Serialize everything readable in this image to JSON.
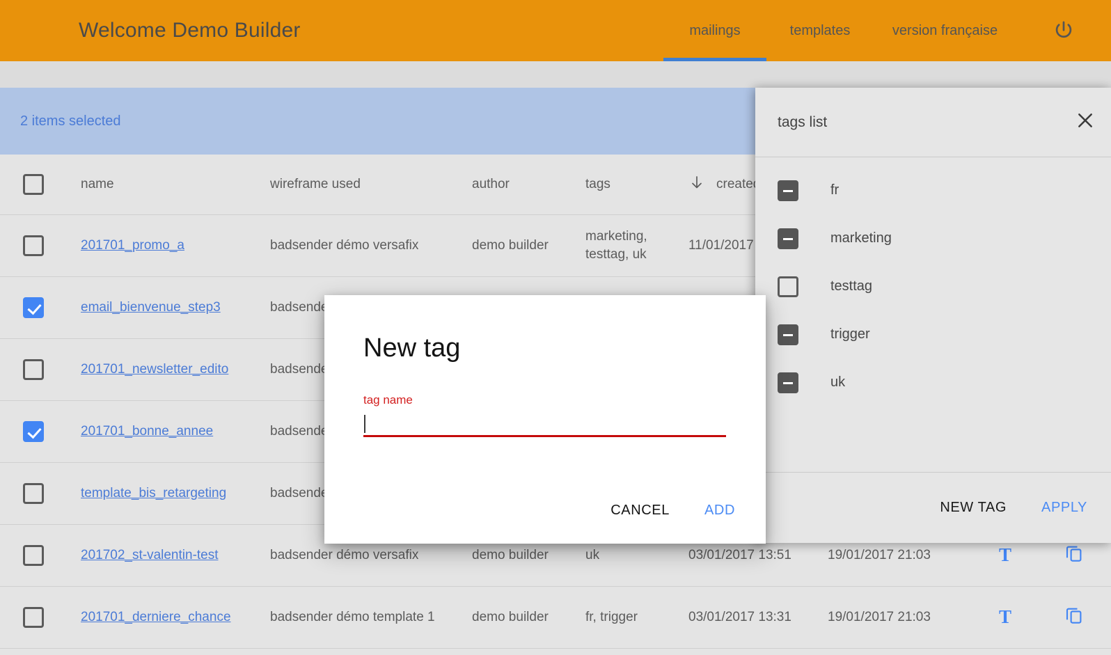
{
  "header": {
    "brand": "Welcome Demo Builder",
    "nav": [
      {
        "label": "mailings",
        "active": true
      },
      {
        "label": "templates",
        "active": false
      },
      {
        "label": "version française",
        "active": false
      }
    ],
    "power_icon": "power-icon"
  },
  "selection_bar": {
    "text": "2 items selected"
  },
  "table": {
    "columns": {
      "name": "name",
      "wireframe": "wireframe used",
      "author": "author",
      "tags": "tags",
      "created": "created",
      "sort_icon": "arrow-down-icon"
    },
    "rows": [
      {
        "checked": false,
        "name": "201701_promo_a",
        "wireframe": "badsender démo versafix",
        "author": "demo builder",
        "tags": "marketing, testtag, uk",
        "created": "11/01/2017",
        "updated": "",
        "action_text": "",
        "action_copy": ""
      },
      {
        "checked": true,
        "name": "email_bienvenue_step3",
        "wireframe": "badsende",
        "author": "",
        "tags": "",
        "created": "",
        "updated": "",
        "action_text": "",
        "action_copy": ""
      },
      {
        "checked": false,
        "name": "201701_newsletter_edito",
        "wireframe": "badsende",
        "author": "",
        "tags": "",
        "created": "",
        "updated": "",
        "action_text": "",
        "action_copy": ""
      },
      {
        "checked": true,
        "name": "201701_bonne_annee",
        "wireframe": "badsende",
        "author": "",
        "tags": "",
        "created": "",
        "updated": "",
        "action_text": "",
        "action_copy": ""
      },
      {
        "checked": false,
        "name": "template_bis_retargeting",
        "wireframe": "badsende",
        "author": "",
        "tags": "",
        "created": "",
        "updated": "",
        "action_text": "",
        "action_copy": ""
      },
      {
        "checked": false,
        "name": "201702_st-valentin-test",
        "wireframe": "badsender démo versafix",
        "author": "demo builder",
        "tags": "uk",
        "created": "03/01/2017 13:51",
        "updated": "19/01/2017 21:03",
        "action_text": "T",
        "action_copy": "copy-icon"
      },
      {
        "checked": false,
        "name": "201701_derniere_chance",
        "wireframe": "badsender démo template 1",
        "author": "demo builder",
        "tags": "fr, trigger",
        "created": "03/01/2017 13:31",
        "updated": "19/01/2017 21:03",
        "action_text": "T",
        "action_copy": "copy-icon"
      }
    ]
  },
  "tags_panel": {
    "title": "tags list",
    "close_icon": "close-icon",
    "items": [
      {
        "label": "fr",
        "state": "indeterminate"
      },
      {
        "label": "marketing",
        "state": "indeterminate"
      },
      {
        "label": "testtag",
        "state": "unchecked"
      },
      {
        "label": "trigger",
        "state": "indeterminate"
      },
      {
        "label": "uk",
        "state": "indeterminate"
      }
    ],
    "new_tag_label": "NEW TAG",
    "apply_label": "APPLY"
  },
  "modal": {
    "title": "New tag",
    "field_label": "tag name",
    "field_value": "",
    "field_placeholder": "",
    "cancel_label": "CANCEL",
    "add_label": "ADD"
  },
  "colors": {
    "brand_orange": "#E8920B",
    "accent_blue": "#4285F4",
    "selection_blue": "#AFC4E5",
    "error_red": "#C50B0B",
    "page_gray": "#E4E4E4"
  }
}
